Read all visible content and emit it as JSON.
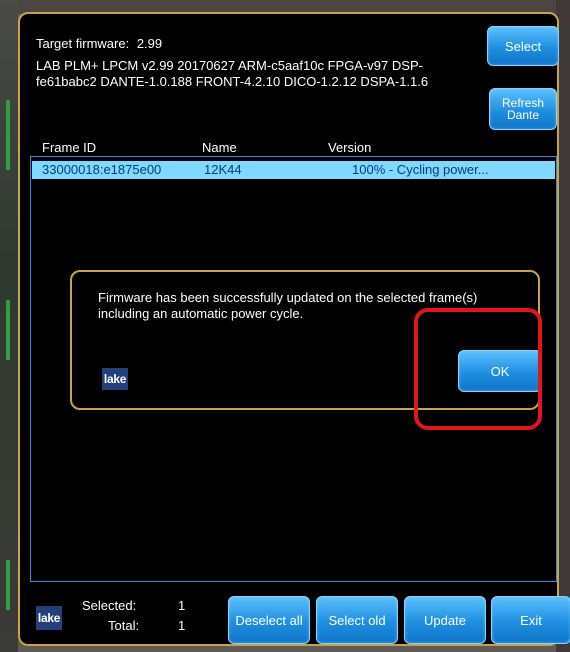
{
  "header": {
    "target_firmware_label": "Target firmware:",
    "target_firmware_value": "2.99",
    "firmware_info": "LAB PLM+ LPCM v2.99 20170627 ARM-c5aaf10c FPGA-v97 DSP-fe61babc2 DANTE-1.0.188 FRONT-4.2.10 DICO-1.2.12 DSPA-1.1.6",
    "select_label": "Select",
    "refresh_line1": "Refresh",
    "refresh_line2": "Dante"
  },
  "table": {
    "columns": [
      "Frame ID",
      "Name",
      "Version"
    ],
    "rows": [
      {
        "frame_id": "33000018:e1875e00",
        "name": "12K44",
        "version": "100% - Cycling power..."
      }
    ]
  },
  "dialog": {
    "message": "Firmware has been successfully updated on the selected frame(s) including an automatic power cycle.",
    "ok_label": "OK",
    "logo_text": "lake"
  },
  "footer": {
    "logo_text": "lake",
    "selected_label": "Selected:",
    "selected_value": "1",
    "total_label": "Total:",
    "total_value": "1",
    "buttons": [
      "Deselect all",
      "Select old",
      "Update",
      "Exit"
    ]
  },
  "colors": {
    "accent": "#1e8fe0",
    "frame_border": "#c9a24a",
    "highlight": "#e0161c",
    "row_selected": "#7fd8ff"
  }
}
